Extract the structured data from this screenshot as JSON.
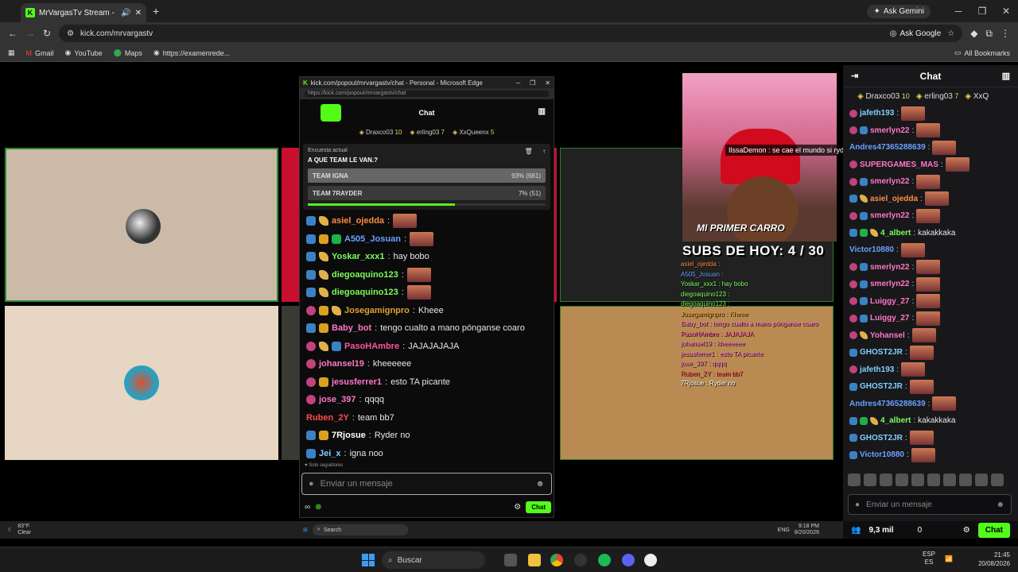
{
  "browser": {
    "tab_title": "MrVargasTv Stream - Watch",
    "url": "kick.com/mrvargastv",
    "ask_gemini": "Ask Gemini",
    "ask_google": "Ask Google",
    "bookmarks": [
      "Gmail",
      "YouTube",
      "Maps",
      "https://examenrede..."
    ],
    "all_bookmarks": "All Bookmarks"
  },
  "popout": {
    "title": "kick.com/popout/mrvargastv/chat - Personal - Microsoft Edge",
    "url": "https://kick.com/popout/mrvargastv/chat",
    "header": "Chat",
    "top_gifters": [
      {
        "name": "Draxco03",
        "count": "10"
      },
      {
        "name": "erling03",
        "count": "7"
      },
      {
        "name": "XxQueenx",
        "count": "5"
      }
    ],
    "poll": {
      "label": "Encuesta actual",
      "question": "A QUE TEAM LE VAN.?",
      "options": [
        {
          "name": "TEAM IGNA",
          "result": "93% (681)",
          "pct": 93
        },
        {
          "name": "TEAM 7RAYDER",
          "result": "7% (51)",
          "pct": 7
        }
      ]
    },
    "messages": [
      {
        "user": "asiel_ojedda",
        "color": "#ff8c42",
        "text": "",
        "emote": true,
        "badges": [
          "sub",
          "ban"
        ]
      },
      {
        "user": "A505_Josuan",
        "color": "#6aa0ff",
        "text": "",
        "emote": true,
        "badges": [
          "sub",
          "crown",
          "green"
        ]
      },
      {
        "user": "Yoskar_xxx1",
        "color": "#7cfc5a",
        "text": "hay bobo",
        "emote": false,
        "badges": [
          "sub",
          "ban"
        ]
      },
      {
        "user": "diegoaquino123",
        "color": "#7cfc5a",
        "text": "",
        "emote": true,
        "badges": [
          "sub",
          "ban"
        ]
      },
      {
        "user": "diegoaquino123",
        "color": "#7cfc5a",
        "text": "",
        "emote": true,
        "badges": [
          "sub",
          "ban"
        ]
      },
      {
        "user": "Josegamignpro",
        "color": "#e0a030",
        "text": "Kheee",
        "emote": false,
        "badges": [
          "pink",
          "crown",
          "ban"
        ]
      },
      {
        "user": "Baby_bot",
        "color": "#ff77c8",
        "text": "tengo cualto a mano pónganse coaro",
        "emote": false,
        "badges": [
          "sub",
          "crown"
        ]
      },
      {
        "user": "PasoHAmbre",
        "color": "#ff5599",
        "text": "JAJAJAJAJA",
        "emote": false,
        "badges": [
          "pink",
          "ban",
          "sub"
        ]
      },
      {
        "user": "johansel19",
        "color": "#ff77c8",
        "text": "kheeeeee",
        "emote": false,
        "badges": [
          "pink"
        ]
      },
      {
        "user": "jesusferrer1",
        "color": "#ff77c8",
        "text": "esto TA picante",
        "emote": false,
        "badges": [
          "pink",
          "crown"
        ]
      },
      {
        "user": "jose_397",
        "color": "#ff77c8",
        "text": "qqqq",
        "emote": false,
        "badges": [
          "pink"
        ]
      },
      {
        "user": "Ruben_2Y",
        "color": "#ff4d4d",
        "text": "team bb7",
        "emote": false,
        "badges": []
      },
      {
        "user": "7Rjosue",
        "color": "#ffffff",
        "text": "Ryder no",
        "emote": false,
        "badges": [
          "sub",
          "crown"
        ]
      },
      {
        "user": "Jei_x",
        "color": "#7fd0ff",
        "text": "igna noo",
        "emote": false,
        "badges": [
          "sub"
        ]
      }
    ],
    "followers_only": "Solo seguidores",
    "input_placeholder": "Enviar un mensaje",
    "send_label": "Chat",
    "infinity": "∞"
  },
  "stream": {
    "overlay_message": "IlssaDemon : se cae el mundo si ryder le dise eso a igna",
    "cam_label": "MI PRIMER CARRO",
    "subs_label": "SUBS DE HOY: 4 / 30",
    "overlay_chat": [
      "asiel_ojedda :",
      "A505_Josuan :",
      "Yoskar_xxx1 : hay bobo",
      "diegoaquino123 :",
      "diegoaquino123 :",
      "Josegamignpro : Kheee",
      "Baby_bot : tengo cualto a mano pónganse coaro",
      "PasoHAmbre : JAJAJAJA",
      "johansel19 : kheeeeee",
      "jesusferrer1 : esto TA picante",
      "jose_397 : qqqq",
      "Ruben_2Y : team bb7",
      "7Rjosue : Ryder no"
    ]
  },
  "side_chat": {
    "title": "Chat",
    "top_gifters": [
      {
        "name": "Draxco03",
        "count": "10"
      },
      {
        "name": "erling03",
        "count": "7"
      },
      {
        "name": "XxQ",
        "count": ""
      }
    ],
    "messages": [
      {
        "user": "jafeth193",
        "color": "#7fd0ff",
        "text": "",
        "emote": true,
        "badges": [
          "pink"
        ]
      },
      {
        "user": "smerlyn22",
        "color": "#ff77c8",
        "text": "",
        "emote": true,
        "badges": [
          "pink",
          "sub"
        ]
      },
      {
        "user": "Andres47365288639",
        "color": "#6aa0ff",
        "text": "",
        "emote": true,
        "badges": []
      },
      {
        "user": "SUPERGAMES_MAS",
        "color": "#ff77c8",
        "text": "",
        "emote": true,
        "badges": [
          "pink"
        ]
      },
      {
        "user": "smerlyn22",
        "color": "#ff77c8",
        "text": "",
        "emote": true,
        "badges": [
          "pink",
          "sub"
        ]
      },
      {
        "user": "asiel_ojedda",
        "color": "#ff8c42",
        "text": "",
        "emote": true,
        "badges": [
          "sub",
          "ban"
        ]
      },
      {
        "user": "smerlyn22",
        "color": "#ff77c8",
        "text": "",
        "emote": true,
        "badges": [
          "pink",
          "sub"
        ]
      },
      {
        "user": "4_albert",
        "color": "#7cfc5a",
        "text": "kakakkaka",
        "emote": false,
        "badges": [
          "sub",
          "green",
          "ban"
        ]
      },
      {
        "user": "Victor10880",
        "color": "#6aa0ff",
        "text": "",
        "emote": true,
        "badges": []
      },
      {
        "user": "smerlyn22",
        "color": "#ff77c8",
        "text": "",
        "emote": true,
        "badges": [
          "pink",
          "sub"
        ]
      },
      {
        "user": "smerlyn22",
        "color": "#ff77c8",
        "text": "",
        "emote": true,
        "badges": [
          "pink",
          "sub"
        ]
      },
      {
        "user": "Luiggy_27",
        "color": "#ff77c8",
        "text": "",
        "emote": true,
        "badges": [
          "pink",
          "sub"
        ]
      },
      {
        "user": "Luiggy_27",
        "color": "#ff77c8",
        "text": "",
        "emote": true,
        "badges": [
          "pink",
          "sub"
        ]
      },
      {
        "user": "Yohansel",
        "color": "#ff77c8",
        "text": "",
        "emote": true,
        "badges": [
          "pink",
          "ban"
        ]
      },
      {
        "user": "GHOST2JR",
        "color": "#7fd0ff",
        "text": "",
        "emote": true,
        "badges": [
          "sub"
        ]
      },
      {
        "user": "jafeth193",
        "color": "#7fd0ff",
        "text": "",
        "emote": true,
        "badges": [
          "pink"
        ]
      },
      {
        "user": "GHOST2JR",
        "color": "#7fd0ff",
        "text": "",
        "emote": true,
        "badges": [
          "sub"
        ]
      },
      {
        "user": "Andres47365288639",
        "color": "#6aa0ff",
        "text": "",
        "emote": true,
        "badges": []
      },
      {
        "user": "4_albert",
        "color": "#7cfc5a",
        "text": "kakakkaka",
        "emote": false,
        "badges": [
          "sub",
          "green",
          "ban"
        ]
      },
      {
        "user": "GHOST2JR",
        "color": "#7fd0ff",
        "text": "",
        "emote": true,
        "badges": [
          "sub"
        ]
      },
      {
        "user": "Victor10880",
        "color": "#6aa0ff",
        "text": "",
        "emote": true,
        "badges": [
          "sub"
        ]
      }
    ],
    "input_placeholder": "Enviar un mensaje",
    "viewers": "9,3 mil",
    "zero": "0",
    "send_label": "Chat"
  },
  "inner_taskbar": {
    "weather_temp": "83°F",
    "weather_desc": "Clear",
    "search": "Search",
    "lang": "ENG",
    "time": "9:18 PM",
    "date": "8/20/2026"
  },
  "taskbar": {
    "search": "Buscar",
    "lang1": "ESP",
    "lang2": "ES",
    "time": "21:45",
    "date": "20/08/2026"
  }
}
